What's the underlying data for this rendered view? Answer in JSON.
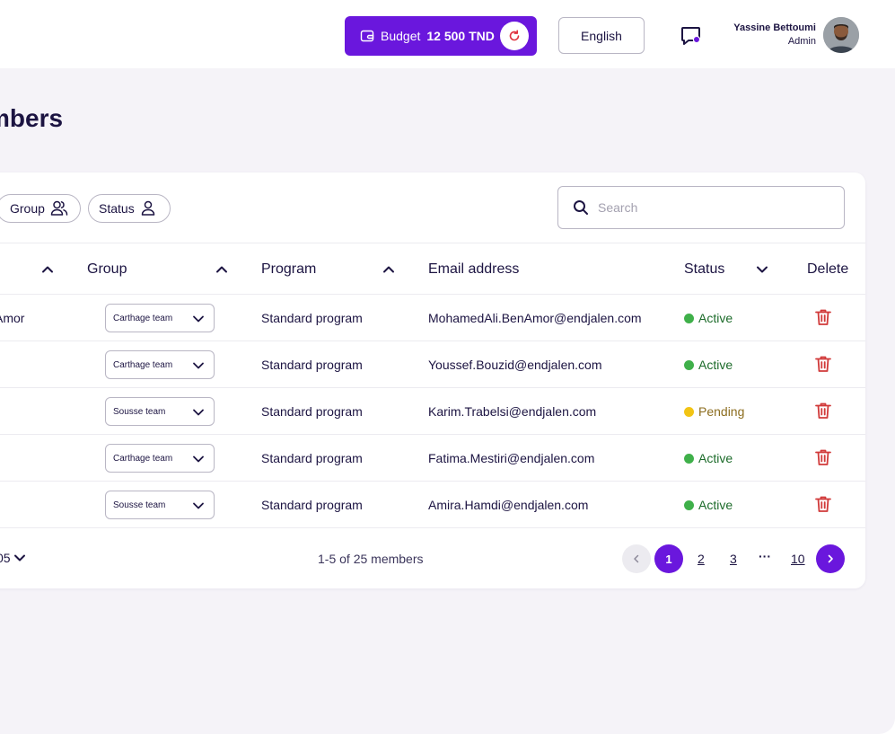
{
  "header": {
    "budget_label": "Budget",
    "budget_amount": "12 500 TND",
    "language": "English",
    "user_name": "Yassine Bettoumi",
    "user_role": "Admin"
  },
  "page": {
    "title": "mbers"
  },
  "filters": {
    "group_label": "Group",
    "status_label": "Status",
    "search_placeholder": "Search"
  },
  "table": {
    "columns": {
      "group": "Group",
      "program": "Program",
      "email": "Email address",
      "status": "Status",
      "delete": "Delete"
    },
    "rows": [
      {
        "name_fragment": "Amor",
        "group": "Carthage team",
        "program": "Standard program",
        "email": "MohamedAli.BenAmor@endjalen.com",
        "status": "Active"
      },
      {
        "name_fragment": "",
        "group": "Carthage team",
        "program": "Standard program",
        "email": "Youssef.Bouzid@endjalen.com",
        "status": "Active"
      },
      {
        "name_fragment": "",
        "group": "Sousse team",
        "program": "Standard program",
        "email": "Karim.Trabelsi@endjalen.com",
        "status": "Pending"
      },
      {
        "name_fragment": "",
        "group": "Carthage team",
        "program": "Standard program",
        "email": "Fatima.Mestiri@endjalen.com",
        "status": "Active"
      },
      {
        "name_fragment": "",
        "group": "Sousse team",
        "program": "Standard program",
        "email": "Amira.Hamdi@endjalen.com",
        "status": "Active"
      }
    ]
  },
  "footer": {
    "rows_per_page": "05",
    "range": "1-5 of 25 members",
    "pages": [
      "1",
      "2",
      "3",
      "10"
    ],
    "ellipsis": "···",
    "current_page": "1"
  },
  "colors": {
    "brand": "#6a17dd",
    "active": "#3fb04a",
    "pending": "#f2c414",
    "pending_text": "#8c6d1f",
    "delete": "#d13a3a",
    "text": "#1c1442"
  },
  "icons": {
    "wallet": "wallet-icon",
    "refresh": "refresh-icon",
    "chat": "chat-icon",
    "users": "users-icon",
    "user": "user-icon",
    "search": "search-icon",
    "sort": "chevron-up-icon",
    "trash": "trash-icon",
    "select": "chevron-down-icon"
  }
}
